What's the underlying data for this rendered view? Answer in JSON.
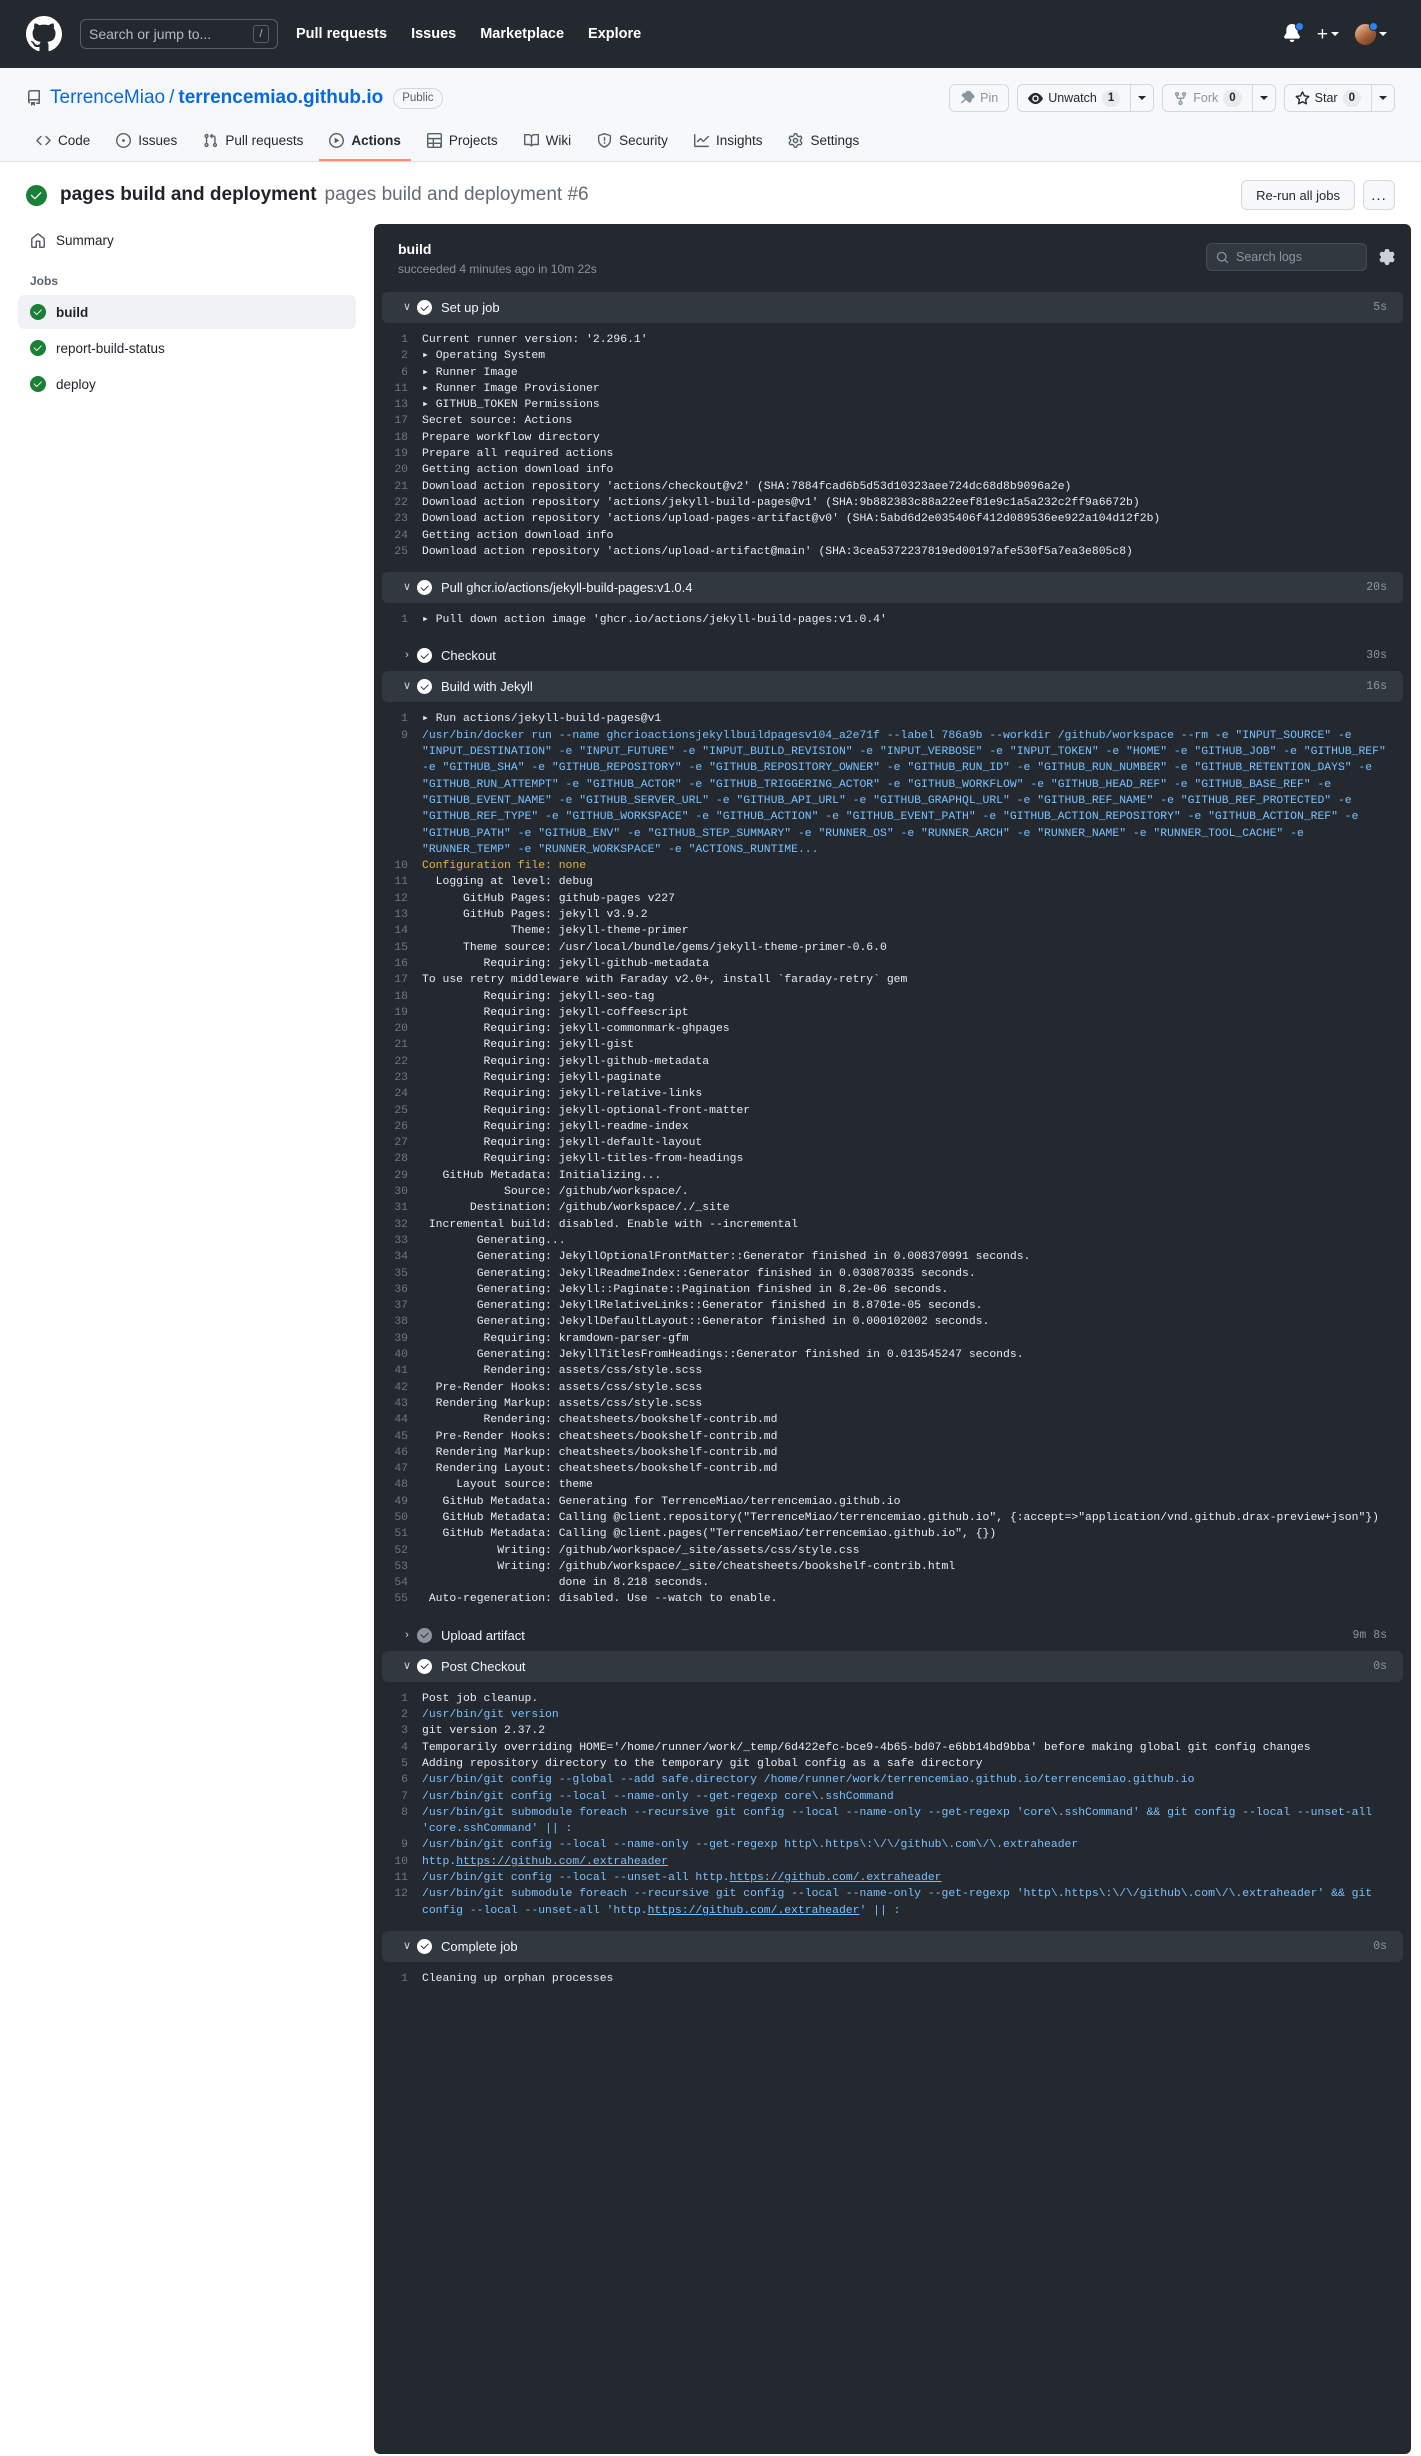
{
  "header": {
    "logo_icon": "github-mark-icon",
    "search": {
      "placeholder": "Search or jump to...",
      "shortcut": "/"
    },
    "nav": [
      {
        "label": "Pull requests"
      },
      {
        "label": "Issues"
      },
      {
        "label": "Marketplace"
      },
      {
        "label": "Explore"
      }
    ],
    "notifications_icon": "bell-icon",
    "create_new_icon": "plus-icon",
    "avatar_icon": "user-avatar"
  },
  "repo": {
    "icon": "repo-icon",
    "owner": "TerrenceMiao",
    "separator": "/",
    "name": "terrencemiao.github.io",
    "visibility": "Public",
    "actions": {
      "pin_label": "Pin",
      "watch_label": "Unwatch",
      "watch_count": "1",
      "fork_label": "Fork",
      "fork_count": "0",
      "star_label": "Star",
      "star_count": "0"
    },
    "tabs": [
      {
        "label": "Code",
        "icon": "code-icon",
        "active": false
      },
      {
        "label": "Issues",
        "icon": "issue-opened-icon",
        "active": false
      },
      {
        "label": "Pull requests",
        "icon": "git-pull-request-icon",
        "active": false
      },
      {
        "label": "Actions",
        "icon": "play-icon",
        "active": true
      },
      {
        "label": "Projects",
        "icon": "table-icon",
        "active": false
      },
      {
        "label": "Wiki",
        "icon": "book-icon",
        "active": false
      },
      {
        "label": "Security",
        "icon": "shield-icon",
        "active": false
      },
      {
        "label": "Insights",
        "icon": "graph-icon",
        "active": false
      },
      {
        "label": "Settings",
        "icon": "gear-icon",
        "active": false
      }
    ]
  },
  "run": {
    "status_icon": "check-circle-icon",
    "title": "pages build and deployment",
    "subtitle": "pages build and deployment #6",
    "rerun_label": "Re-run all jobs",
    "kebab_label": "..."
  },
  "sidebar": {
    "summary_label": "Summary",
    "summary_icon": "home-icon",
    "jobs_heading": "Jobs",
    "jobs": [
      {
        "label": "build",
        "selected": true
      },
      {
        "label": "report-build-status",
        "selected": false
      },
      {
        "label": "deploy",
        "selected": false
      }
    ]
  },
  "log_panel": {
    "title": "build",
    "subtitle": "succeeded 4 minutes ago in 10m 22s",
    "search_placeholder": "Search logs",
    "search_icon": "search-icon",
    "settings_icon": "gear-icon",
    "steps": [
      {
        "name": "Set up job",
        "duration": "5s",
        "expanded": true,
        "lines": [
          {
            "n": "1",
            "t": "Current runner version: '2.296.1'"
          },
          {
            "n": "2",
            "t": "▸ Operating System"
          },
          {
            "n": "6",
            "t": "▸ Runner Image"
          },
          {
            "n": "11",
            "t": "▸ Runner Image Provisioner"
          },
          {
            "n": "13",
            "t": "▸ GITHUB_TOKEN Permissions"
          },
          {
            "n": "17",
            "t": "Secret source: Actions"
          },
          {
            "n": "18",
            "t": "Prepare workflow directory"
          },
          {
            "n": "19",
            "t": "Prepare all required actions"
          },
          {
            "n": "20",
            "t": "Getting action download info"
          },
          {
            "n": "21",
            "t": "Download action repository 'actions/checkout@v2' (SHA:7884fcad6b5d53d10323aee724dc68d8b9096a2e)"
          },
          {
            "n": "22",
            "t": "Download action repository 'actions/jekyll-build-pages@v1' (SHA:9b882383c88a22eef81e9c1a5a232c2ff9a6672b)"
          },
          {
            "n": "23",
            "t": "Download action repository 'actions/upload-pages-artifact@v0' (SHA:5abd6d2e035406f412d089536ee922a104d12f2b)"
          },
          {
            "n": "24",
            "t": "Getting action download info"
          },
          {
            "n": "25",
            "t": "Download action repository 'actions/upload-artifact@main' (SHA:3cea5372237819ed00197afe530f5a7ea3e805c8)"
          }
        ]
      },
      {
        "name": "Pull ghcr.io/actions/jekyll-build-pages:v1.0.4",
        "duration": "20s",
        "expanded": true,
        "lines": [
          {
            "n": "1",
            "t": "▸ Pull down action image 'ghcr.io/actions/jekyll-build-pages:v1.0.4'"
          }
        ]
      },
      {
        "name": "Checkout",
        "duration": "30s",
        "expanded": false,
        "lines": []
      },
      {
        "name": "Build with Jekyll",
        "duration": "16s",
        "expanded": true,
        "lines": [
          {
            "n": "1",
            "t": "▸ Run actions/jekyll-build-pages@v1"
          },
          {
            "n": "9",
            "t": "/usr/bin/docker run --name ghcrioactionsjekyllbuildpagesv104_a2e71f --label 786a9b --workdir /github/workspace --rm -e \"INPUT_SOURCE\" -e \"INPUT_DESTINATION\" -e \"INPUT_FUTURE\" -e \"INPUT_BUILD_REVISION\" -e \"INPUT_VERBOSE\" -e \"INPUT_TOKEN\" -e \"HOME\" -e \"GITHUB_JOB\" -e \"GITHUB_REF\" -e \"GITHUB_SHA\" -e \"GITHUB_REPOSITORY\" -e \"GITHUB_REPOSITORY_OWNER\" -e \"GITHUB_RUN_ID\" -e \"GITHUB_RUN_NUMBER\" -e \"GITHUB_RETENTION_DAYS\" -e \"GITHUB_RUN_ATTEMPT\" -e \"GITHUB_ACTOR\" -e \"GITHUB_TRIGGERING_ACTOR\" -e \"GITHUB_WORKFLOW\" -e \"GITHUB_HEAD_REF\" -e \"GITHUB_BASE_REF\" -e \"GITHUB_EVENT_NAME\" -e \"GITHUB_SERVER_URL\" -e \"GITHUB_API_URL\" -e \"GITHUB_GRAPHQL_URL\" -e \"GITHUB_REF_NAME\" -e \"GITHUB_REF_PROTECTED\" -e \"GITHUB_REF_TYPE\" -e \"GITHUB_WORKSPACE\" -e \"GITHUB_ACTION\" -e \"GITHUB_EVENT_PATH\" -e \"GITHUB_ACTION_REPOSITORY\" -e \"GITHUB_ACTION_REF\" -e \"GITHUB_PATH\" -e \"GITHUB_ENV\" -e \"GITHUB_STEP_SUMMARY\" -e \"RUNNER_OS\" -e \"RUNNER_ARCH\" -e \"RUNNER_NAME\" -e \"RUNNER_TOOL_CACHE\" -e \"RUNNER_TEMP\" -e \"RUNNER_WORKSPACE\" -e \"ACTIONS_RUNTIME...",
            "color": "blue"
          },
          {
            "n": "10",
            "t": "Configuration file: none",
            "color": "yellow"
          },
          {
            "n": "11",
            "t": "  Logging at level: debug"
          },
          {
            "n": "12",
            "t": "      GitHub Pages: github-pages v227"
          },
          {
            "n": "13",
            "t": "      GitHub Pages: jekyll v3.9.2"
          },
          {
            "n": "14",
            "t": "             Theme: jekyll-theme-primer"
          },
          {
            "n": "15",
            "t": "      Theme source: /usr/local/bundle/gems/jekyll-theme-primer-0.6.0"
          },
          {
            "n": "16",
            "t": "         Requiring: jekyll-github-metadata"
          },
          {
            "n": "17",
            "t": "To use retry middleware with Faraday v2.0+, install `faraday-retry` gem"
          },
          {
            "n": "18",
            "t": "         Requiring: jekyll-seo-tag"
          },
          {
            "n": "19",
            "t": "         Requiring: jekyll-coffeescript"
          },
          {
            "n": "20",
            "t": "         Requiring: jekyll-commonmark-ghpages"
          },
          {
            "n": "21",
            "t": "         Requiring: jekyll-gist"
          },
          {
            "n": "22",
            "t": "         Requiring: jekyll-github-metadata"
          },
          {
            "n": "23",
            "t": "         Requiring: jekyll-paginate"
          },
          {
            "n": "24",
            "t": "         Requiring: jekyll-relative-links"
          },
          {
            "n": "25",
            "t": "         Requiring: jekyll-optional-front-matter"
          },
          {
            "n": "26",
            "t": "         Requiring: jekyll-readme-index"
          },
          {
            "n": "27",
            "t": "         Requiring: jekyll-default-layout"
          },
          {
            "n": "28",
            "t": "         Requiring: jekyll-titles-from-headings"
          },
          {
            "n": "29",
            "t": "   GitHub Metadata: Initializing..."
          },
          {
            "n": "30",
            "t": "            Source: /github/workspace/."
          },
          {
            "n": "31",
            "t": "       Destination: /github/workspace/./_site"
          },
          {
            "n": "32",
            "t": " Incremental build: disabled. Enable with --incremental"
          },
          {
            "n": "33",
            "t": "        Generating..."
          },
          {
            "n": "34",
            "t": "        Generating: JekyllOptionalFrontMatter::Generator finished in 0.008370991 seconds."
          },
          {
            "n": "35",
            "t": "        Generating: JekyllReadmeIndex::Generator finished in 0.030870335 seconds."
          },
          {
            "n": "36",
            "t": "        Generating: Jekyll::Paginate::Pagination finished in 8.2e-06 seconds."
          },
          {
            "n": "37",
            "t": "        Generating: JekyllRelativeLinks::Generator finished in 8.8701e-05 seconds."
          },
          {
            "n": "38",
            "t": "        Generating: JekyllDefaultLayout::Generator finished in 0.000102002 seconds."
          },
          {
            "n": "39",
            "t": "         Requiring: kramdown-parser-gfm"
          },
          {
            "n": "40",
            "t": "        Generating: JekyllTitlesFromHeadings::Generator finished in 0.013545247 seconds."
          },
          {
            "n": "41",
            "t": "         Rendering: assets/css/style.scss"
          },
          {
            "n": "42",
            "t": "  Pre-Render Hooks: assets/css/style.scss"
          },
          {
            "n": "43",
            "t": "  Rendering Markup: assets/css/style.scss"
          },
          {
            "n": "44",
            "t": "         Rendering: cheatsheets/bookshelf-contrib.md"
          },
          {
            "n": "45",
            "t": "  Pre-Render Hooks: cheatsheets/bookshelf-contrib.md"
          },
          {
            "n": "46",
            "t": "  Rendering Markup: cheatsheets/bookshelf-contrib.md"
          },
          {
            "n": "47",
            "t": "  Rendering Layout: cheatsheets/bookshelf-contrib.md"
          },
          {
            "n": "48",
            "t": "     Layout source: theme"
          },
          {
            "n": "49",
            "t": "   GitHub Metadata: Generating for TerrenceMiao/terrencemiao.github.io"
          },
          {
            "n": "50",
            "t": "   GitHub Metadata: Calling @client.repository(\"TerrenceMiao/terrencemiao.github.io\", {:accept=>\"application/vnd.github.drax-preview+json\"})"
          },
          {
            "n": "51",
            "t": "   GitHub Metadata: Calling @client.pages(\"TerrenceMiao/terrencemiao.github.io\", {})"
          },
          {
            "n": "52",
            "t": "           Writing: /github/workspace/_site/assets/css/style.css"
          },
          {
            "n": "53",
            "t": "           Writing: /github/workspace/_site/cheatsheets/bookshelf-contrib.html"
          },
          {
            "n": "54",
            "t": "                    done in 8.218 seconds."
          },
          {
            "n": "55",
            "t": " Auto-regeneration: disabled. Use --watch to enable."
          }
        ]
      },
      {
        "name": "Upload artifact",
        "duration": "9m 8s",
        "expanded": false,
        "muted": true,
        "lines": []
      },
      {
        "name": "Post Checkout",
        "duration": "0s",
        "expanded": true,
        "lines": [
          {
            "n": "1",
            "t": "Post job cleanup."
          },
          {
            "n": "2",
            "t": "/usr/bin/git version",
            "color": "blue"
          },
          {
            "n": "3",
            "t": "git version 2.37.2"
          },
          {
            "n": "4",
            "t": "Temporarily overriding HOME='/home/runner/work/_temp/6d422efc-bce9-4b65-bd07-e6bb14bd9bba' before making global git config changes"
          },
          {
            "n": "5",
            "t": "Adding repository directory to the temporary git global config as a safe directory"
          },
          {
            "n": "6",
            "t": "/usr/bin/git config --global --add safe.directory /home/runner/work/terrencemiao.github.io/terrencemiao.github.io",
            "color": "blue"
          },
          {
            "n": "7",
            "t": "/usr/bin/git config --local --name-only --get-regexp core\\.sshCommand",
            "color": "blue"
          },
          {
            "n": "8",
            "t": "/usr/bin/git submodule foreach --recursive git config --local --name-only --get-regexp 'core\\.sshCommand' && git config --local --unset-all 'core.sshCommand' || :",
            "color": "blue"
          },
          {
            "n": "9",
            "t": "/usr/bin/git config --local --name-only --get-regexp http\\.https\\:\\/\\/github\\.com\\/\\.extraheader",
            "color": "blue"
          },
          {
            "n": "10",
            "t": "http.https://github.com/.extraheader",
            "color": "blue",
            "underline_from": "https://github.com/.extraheader"
          },
          {
            "n": "11",
            "t": "/usr/bin/git config --local --unset-all http.https://github.com/.extraheader",
            "color": "blue",
            "underline_from": "https://github.com/.extraheader"
          },
          {
            "n": "12",
            "t": "/usr/bin/git submodule foreach --recursive git config --local --name-only --get-regexp 'http\\.https\\:\\/\\/github\\.com\\/\\.extraheader' && git config --local --unset-all 'http.https://github.com/.extraheader' || :",
            "color": "blue",
            "underline_from": "https://github.com/.extraheader"
          }
        ]
      },
      {
        "name": "Complete job",
        "duration": "0s",
        "expanded": true,
        "lines": [
          {
            "n": "1",
            "t": "Cleaning up orphan processes"
          }
        ]
      }
    ]
  }
}
